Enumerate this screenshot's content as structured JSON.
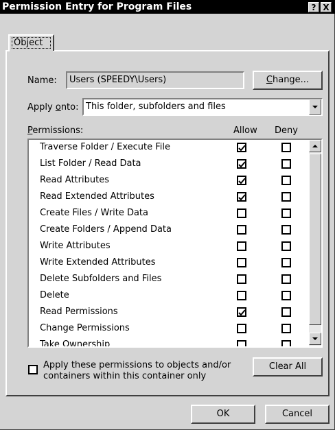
{
  "window": {
    "title": "Permission Entry for Program Files",
    "help_glyph": "?",
    "close_glyph": "X"
  },
  "tabs": [
    {
      "label": "Object"
    }
  ],
  "name": {
    "label": "Name:",
    "value": "Users (SPEEDY\\Users)",
    "change_label": "Change..."
  },
  "apply_onto": {
    "label": "Apply onto:",
    "value": "This folder, subfolders and files"
  },
  "permissions": {
    "label": "Permissions:",
    "allow_header": "Allow",
    "deny_header": "Deny",
    "items": [
      {
        "name": "Traverse Folder / Execute File",
        "allow": true,
        "deny": false
      },
      {
        "name": "List Folder / Read Data",
        "allow": true,
        "deny": false
      },
      {
        "name": "Read Attributes",
        "allow": true,
        "deny": false
      },
      {
        "name": "Read Extended Attributes",
        "allow": true,
        "deny": false
      },
      {
        "name": "Create Files / Write Data",
        "allow": false,
        "deny": false
      },
      {
        "name": "Create Folders / Append Data",
        "allow": false,
        "deny": false
      },
      {
        "name": "Write Attributes",
        "allow": false,
        "deny": false
      },
      {
        "name": "Write Extended Attributes",
        "allow": false,
        "deny": false
      },
      {
        "name": "Delete Subfolders and Files",
        "allow": false,
        "deny": false
      },
      {
        "name": "Delete",
        "allow": false,
        "deny": false
      },
      {
        "name": "Read Permissions",
        "allow": true,
        "deny": false
      },
      {
        "name": "Change Permissions",
        "allow": false,
        "deny": false
      },
      {
        "name": "Take Ownership",
        "allow": false,
        "deny": false
      }
    ]
  },
  "apply_container": {
    "checked": false,
    "line1": "Apply these permissions to objects and/or",
    "line2": "containers within this container only"
  },
  "clear_all_label": "Clear All",
  "ok_label": "OK",
  "cancel_label": "Cancel",
  "icons": {
    "check": "check-icon",
    "scroll_up": "scroll-up-arrow-icon",
    "scroll_down": "scroll-down-arrow-icon",
    "dropdown": "chevron-down-icon"
  }
}
